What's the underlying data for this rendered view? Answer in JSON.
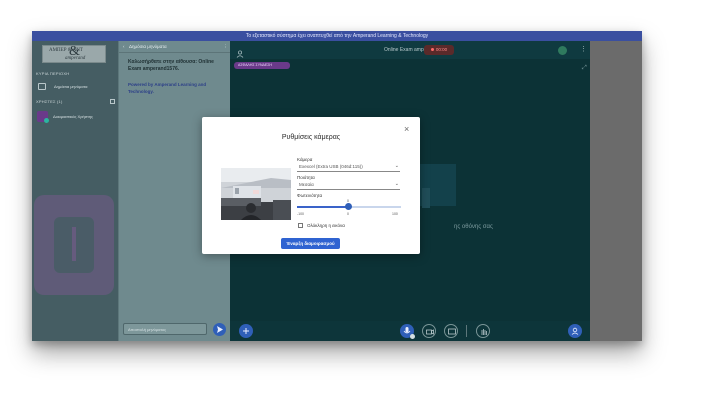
{
  "banner": {
    "text": "Το εξεταστικό σύστημα έχει αναπτυχθεί από την Amperand Learning & Technology"
  },
  "sidebar": {
    "logo_line1": "ΑΜΠΕΡ & ΑΝΤ",
    "logo_line2": "amperand",
    "section_main": "ΚΥΡΙΑ ΠΕΡΙΟΧΗ",
    "item_messages": "Δημόσια μηνύματα",
    "section_users": "ΧΡΗΣΤΕΣ (1)",
    "item_user": "Δοκιμαστικός Χρήστης"
  },
  "chat": {
    "header": "Δημόσια μηνύματα",
    "welcome": "Καλωσήρθατε στην αίθουσα: Online Exam amperand1576.",
    "powered": "Powered by Amperand Learning and Technology.",
    "input_placeholder": "Αποστολή μηνύματος"
  },
  "main": {
    "room_title": "Online Exam amperand1576",
    "rec_time": "00:00",
    "chip_label": "ΑΣΦΑΛΗΣ ΣΥΝΔΕΣΗ",
    "screen_share_text": "ης οθόνης σας"
  },
  "dialog": {
    "title": "Ρυθμίσεις κάμερας",
    "close": "×",
    "camera_label": "Κάμερα",
    "camera_value": "Exexcel (Extra USB (046d:115))",
    "quality_label": "Ποιότητα",
    "quality_value": "Μεσαία",
    "brightness_label": "Φωτεινότητα",
    "slider_value": 0,
    "slider_min": "-100",
    "slider_mid": "0",
    "slider_max": "100",
    "checkbox_label": "Ολόκληρη η εικόνα",
    "start_button": "Έναρξη διαμοιρασμού"
  },
  "colors": {
    "accent": "#2f63d1",
    "record": "#ff8a8a",
    "sidebar_bg": "#455d63",
    "main_bg": "#0c3236"
  }
}
